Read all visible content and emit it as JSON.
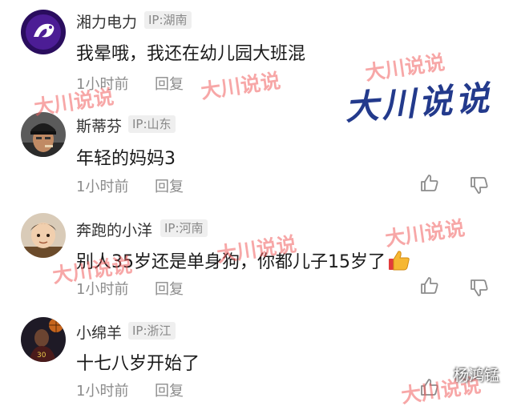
{
  "comments": [
    {
      "username": "湘力电力",
      "ip": "IP:湖南",
      "text": "我晕哦，我还在幼儿园大班混",
      "time": "1小时前",
      "reply": "回复",
      "avatar": "purple-logo-avatar"
    },
    {
      "username": "斯蒂芬",
      "ip": "IP:山东",
      "text": "年轻的妈妈3",
      "time": "1小时前",
      "reply": "回复",
      "avatar": "man-with-cap-avatar"
    },
    {
      "username": "奔跑的小洋",
      "ip": "IP:河南",
      "text": "别人35岁还是单身狗，你都儿子15岁了",
      "time": "1小时前",
      "reply": "回复",
      "avatar": "toddler-avatar",
      "emoji": "thumbs-up-emoji"
    },
    {
      "username": "小绵羊",
      "ip": "IP:浙江",
      "text": "十七八岁开始了",
      "time": "1小时前",
      "reply": "回复",
      "avatar": "basketball-player-avatar"
    }
  ],
  "watermarks": {
    "small": "大川说说",
    "big": "大川说说",
    "signature": "杨鸿锰"
  },
  "colors": {
    "watermark": "#f05f5f",
    "big_watermark": "#233a8c",
    "meta_text": "#8c8c8c"
  }
}
